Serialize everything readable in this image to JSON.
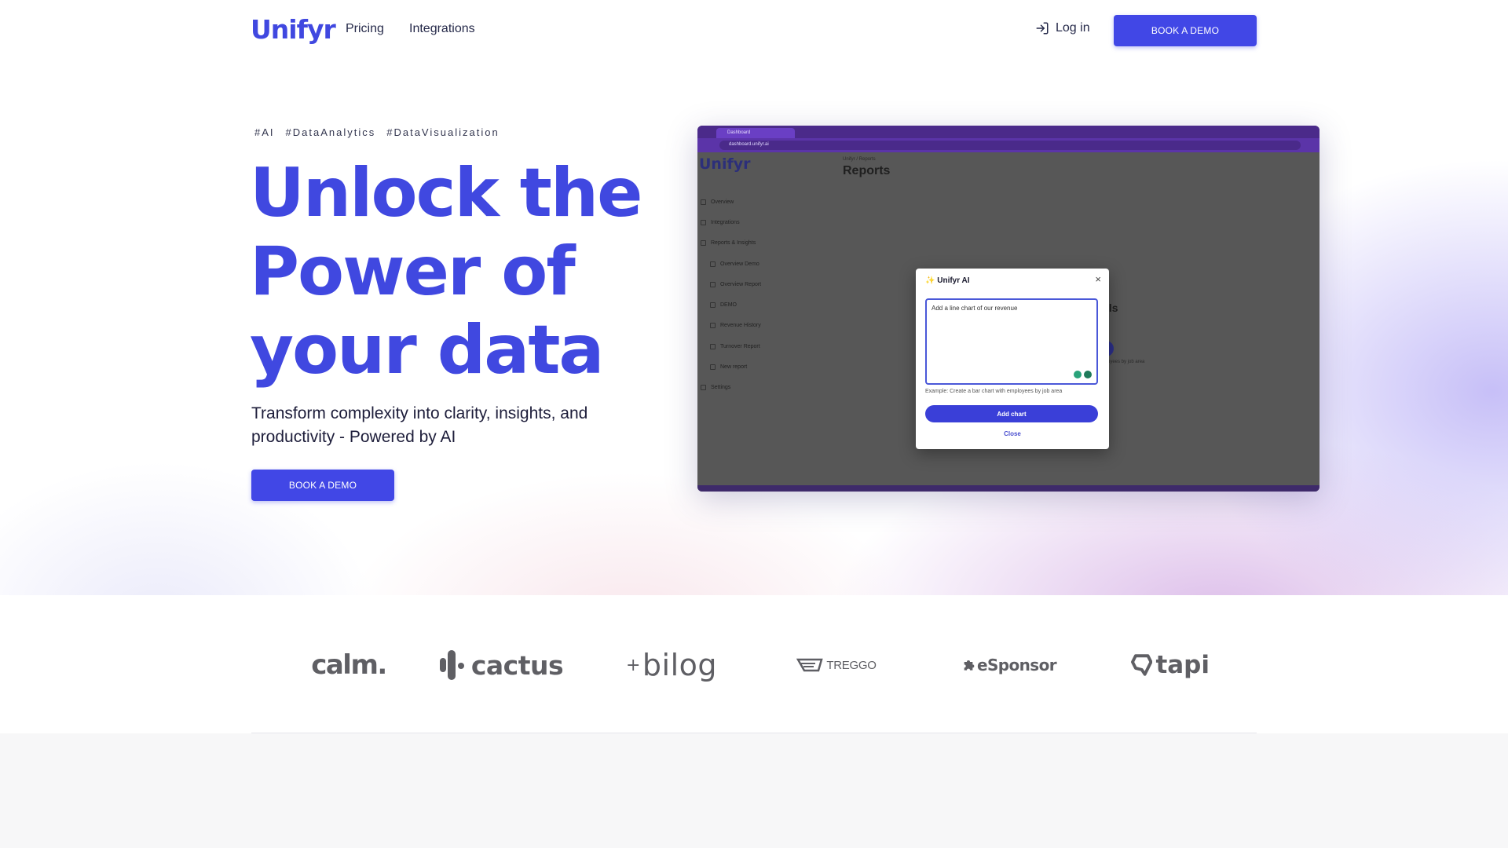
{
  "nav": {
    "logo": "Unifyr",
    "links": [
      "Pricing",
      "Integrations"
    ],
    "login": "Log in",
    "cta": "BOOK A DEMO"
  },
  "hero": {
    "tags": [
      "#AI",
      "#DataAnalytics",
      "#DataVisualization"
    ],
    "headline": "Unlock the Power of your data",
    "subline": "Transform complexity into clarity, insights, and productivity - Powered by AI",
    "cta": "BOOK A DEMO"
  },
  "mock": {
    "tab_label": "Dashboard",
    "url": "dashboard.unifyr.ai",
    "logo": "Unifyr",
    "breadcrumb": "Unifyr / Reports",
    "page_title": "Reports",
    "menu": [
      {
        "label": "Overview",
        "sub": false
      },
      {
        "label": "Integrations",
        "sub": false
      },
      {
        "label": "Reports & Insights",
        "sub": false
      },
      {
        "label": "Overview Demo",
        "sub": true
      },
      {
        "label": "Overview Report",
        "sub": true
      },
      {
        "label": "DEMO",
        "sub": true
      },
      {
        "label": "Revenue History",
        "sub": true
      },
      {
        "label": "Turnover Report",
        "sub": true
      },
      {
        "label": "New report",
        "sub": true
      },
      {
        "label": "Settings",
        "sub": false
      }
    ],
    "partial_heading": "ils",
    "partial_text": "oyees by job area",
    "modal": {
      "title": "Unifyr AI",
      "input_value": "Add a line chart of our revenue",
      "example": "Example: Create a bar chart with employees by job area",
      "add_button": "Add chart",
      "close_button": "Close"
    }
  },
  "clients": [
    "calm.",
    "cactus",
    "bilog",
    "TREGGO",
    "eSponsor",
    "tapi"
  ],
  "colors": {
    "brand": "#4048e0",
    "button": "#4147e6"
  }
}
